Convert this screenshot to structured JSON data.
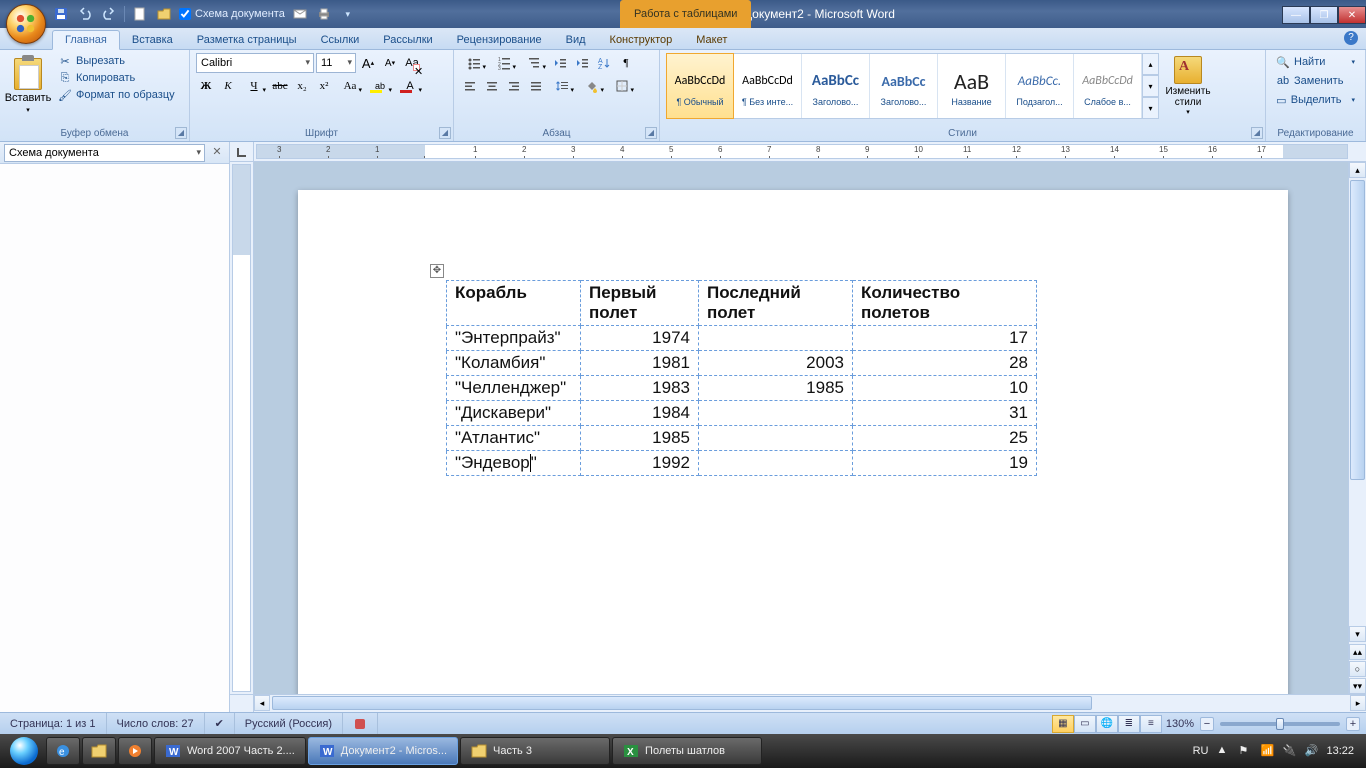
{
  "title_bar": {
    "doc_title": "Документ2 - Microsoft Word",
    "contextual_title": "Работа с таблицами",
    "qat_checkbox_label": "Схема документа"
  },
  "tabs": {
    "home": "Главная",
    "insert": "Вставка",
    "page_layout": "Разметка страницы",
    "references": "Ссылки",
    "mailings": "Рассылки",
    "review": "Рецензирование",
    "view": "Вид",
    "design": "Конструктор",
    "layout": "Макет"
  },
  "clipboard": {
    "paste": "Вставить",
    "cut": "Вырезать",
    "copy": "Копировать",
    "fmt_painter": "Формат по образцу",
    "group_title": "Буфер обмена"
  },
  "font": {
    "name": "Calibri",
    "size": "11",
    "group_title": "Шрифт",
    "grow": "A",
    "shrink": "A",
    "clear": "Aa",
    "bold": "Ж",
    "italic": "К",
    "underline": "Ч",
    "strike": "abc",
    "sub": "x₂",
    "sup": "x²",
    "case": "Aa",
    "highlight": "ab",
    "color": "A"
  },
  "paragraph": {
    "group_title": "Абзац"
  },
  "styles": {
    "group_title": "Стили",
    "items": [
      {
        "preview": "AaBbCcDd",
        "name": "¶ Обычный",
        "preview_style": "font-size:12px;"
      },
      {
        "preview": "AaBbCcDd",
        "name": "¶ Без инте...",
        "preview_style": "font-size:12px;"
      },
      {
        "preview": "AaBbCc",
        "name": "Заголово...",
        "preview_style": "font-size:15px;font-weight:bold;color:#2a5a9a;"
      },
      {
        "preview": "AaBbCc",
        "name": "Заголово...",
        "preview_style": "font-size:14px;font-weight:bold;color:#3a6aaa;"
      },
      {
        "preview": "AaB",
        "name": "Название",
        "preview_style": "font-size:22px;color:#222;"
      },
      {
        "preview": "AaBbCc.",
        "name": "Подзагол...",
        "preview_style": "font-size:13px;font-style:italic;color:#3a6aaa;"
      },
      {
        "preview": "AaBbCcDd",
        "name": "Слабое в...",
        "preview_style": "font-size:12px;font-style:italic;color:#888;"
      }
    ],
    "change_styles": "Изменить стили"
  },
  "editing": {
    "find": "Найти",
    "replace": "Заменить",
    "select": "Выделить",
    "group_title": "Редактирование"
  },
  "docmap": {
    "combo": "Схема документа"
  },
  "ruler_ticks": [
    "3",
    "2",
    "1",
    "",
    "1",
    "2",
    "3",
    "4",
    "5",
    "6",
    "7",
    "8",
    "9",
    "10",
    "11",
    "12",
    "13",
    "14",
    "15",
    "16",
    "17"
  ],
  "table": {
    "headers": {
      "ship": "Корабль",
      "first": "Первый полет",
      "last": "Последний полет",
      "count": "Количество полетов"
    },
    "rows": [
      {
        "ship": "\"Энтерпрайз\"",
        "first": "1974",
        "last": "",
        "count": "17"
      },
      {
        "ship": "\"Коламбия\"",
        "first": "1981",
        "last": "2003",
        "count": "28"
      },
      {
        "ship": "\"Челленджер\"",
        "first": "1983",
        "last": "1985",
        "count": "10"
      },
      {
        "ship": "\"Дискавери\"",
        "first": "1984",
        "last": "",
        "count": "31"
      },
      {
        "ship": "\"Атлантис\"",
        "first": "1985",
        "last": "",
        "count": "25"
      },
      {
        "ship": "\"Эндевор\"",
        "first": "1992",
        "last": "",
        "count": "19",
        "caret": true
      }
    ]
  },
  "status": {
    "page": "Страница: 1 из 1",
    "words": "Число слов: 27",
    "lang": "Русский (Россия)",
    "zoom": "130%"
  },
  "taskbar": {
    "items": [
      {
        "icon": "word",
        "label": "Word 2007 Часть 2...."
      },
      {
        "icon": "word",
        "label": "Документ2 - Micros...",
        "active": true
      },
      {
        "icon": "folder",
        "label": "Часть 3"
      },
      {
        "icon": "excel",
        "label": "Полеты шатлов"
      }
    ],
    "lang": "RU",
    "time": "13:22"
  }
}
